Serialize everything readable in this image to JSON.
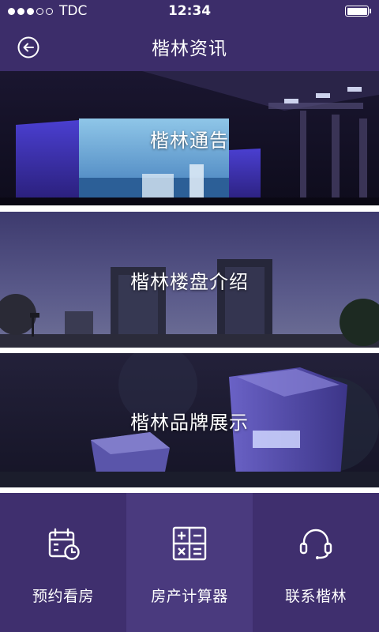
{
  "status_bar": {
    "carrier": "TDC",
    "time": "12:34",
    "signal_bars_filled": 3,
    "signal_bars_total": 5,
    "battery_level": 1.0
  },
  "nav": {
    "title": "楷林资讯",
    "back_icon": "back-arrow-circle-icon"
  },
  "cards": [
    {
      "label": "楷林通告",
      "scene": "conference-stage"
    },
    {
      "label": "楷林楼盘介绍",
      "scene": "night-skyline"
    },
    {
      "label": "楷林品牌展示",
      "scene": "tower-aerial-night"
    }
  ],
  "tabs": [
    {
      "label": "预约看房",
      "icon": "calendar-clock-icon"
    },
    {
      "label": "房产计算器",
      "icon": "calculator-icon"
    },
    {
      "label": "联系楷林",
      "icon": "headset-icon"
    }
  ],
  "colors": {
    "brand": "#3c2d6a",
    "tab_middle": "#4a3a7e",
    "text": "#ffffff"
  }
}
